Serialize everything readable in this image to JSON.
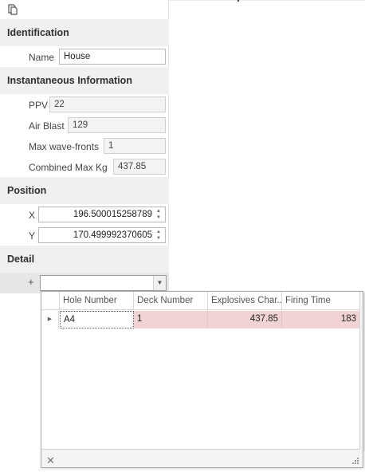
{
  "toolbar": {
    "icon": "copy-document-icon"
  },
  "sections": {
    "identification": "Identification",
    "instantaneous": "Instantaneous Information",
    "position": "Position",
    "detail": "Detail"
  },
  "identification": {
    "name_label": "Name",
    "name_value": "House"
  },
  "instantaneous": {
    "ppv_label": "PPV",
    "ppv_value": "22",
    "airblast_label": "Air Blast",
    "airblast_value": "129",
    "wavefronts_label": "Max wave-fronts",
    "wavefronts_value": "1",
    "maxkg_label": "Combined Max Kg",
    "maxkg_value": "437.85"
  },
  "position": {
    "x_label": "X",
    "x_value": "196.500015258789",
    "y_label": "Y",
    "y_value": "170.499992370605"
  },
  "detail": {
    "expand_symbol": "+",
    "combo_value": ""
  },
  "lookup": {
    "columns": [
      "Hole Number",
      "Deck Number",
      "Explosives Char...",
      "Firing Time"
    ],
    "rows": [
      {
        "hole_number": "A4",
        "deck_number": "1",
        "explosives_charge": "437.85",
        "firing_time": "183"
      }
    ],
    "close_symbol": "✕"
  },
  "colors": {
    "selected_row": "#f2d3d3",
    "section_bg": "#f0f0f0"
  }
}
